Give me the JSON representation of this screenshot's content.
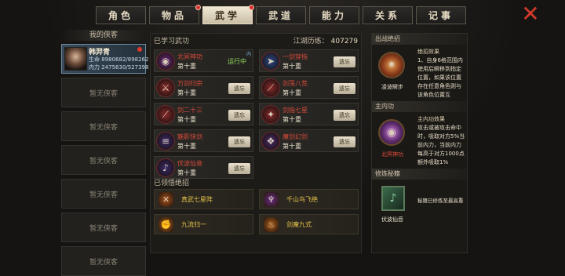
{
  "tabs": [
    {
      "label": "角色",
      "active": false,
      "dot": false
    },
    {
      "label": "物品",
      "active": false,
      "dot": true
    },
    {
      "label": "武学",
      "active": true,
      "dot": true
    },
    {
      "label": "武道",
      "active": false,
      "dot": false
    },
    {
      "label": "能力",
      "active": false,
      "dot": false
    },
    {
      "label": "关系",
      "active": false,
      "dot": false
    },
    {
      "label": "记事",
      "active": false,
      "dot": false
    }
  ],
  "left": {
    "title": "我的侠客",
    "hero": {
      "name": "韩羿青",
      "hp_label": "生命",
      "hp": "8980682/898262",
      "mp_label": "内力",
      "mp": "2475630/527398"
    },
    "empty_slot": "暂无侠客"
  },
  "middle": {
    "header": "已学习武功",
    "exp_label": "江湖历练：",
    "exp_value": "407279",
    "skills": [
      {
        "name": "北冥神功",
        "level": "第十重",
        "status": "运行中",
        "tag": "内",
        "icon": "swirl-icon",
        "color": "#6a2a7a"
      },
      {
        "name": "一剑穿指",
        "level": "第十重",
        "status": "遗忘",
        "icon": "arrow-icon",
        "color": "#2a4a8a"
      },
      {
        "name": "万剑归宗",
        "level": "第十重",
        "status": "遗忘",
        "icon": "sword-icon",
        "color": "#8a2a2a"
      },
      {
        "name": "剑荡八荒",
        "level": "第十重",
        "status": "遗忘",
        "icon": "slash-icon",
        "color": "#8a2a2a"
      },
      {
        "name": "剑二十三",
        "level": "第十重",
        "status": "遗忘",
        "icon": "blade-icon",
        "color": "#8a2a2a"
      },
      {
        "name": "剑指七星",
        "level": "第十重",
        "status": "遗忘",
        "icon": "star-icon",
        "color": "#8a2a2a"
      },
      {
        "name": "魅影快剑",
        "level": "第十重",
        "status": "遗忘",
        "icon": "strike-icon",
        "color": "#3a2a6a"
      },
      {
        "name": "魔剑幻剑",
        "level": "第十重",
        "status": "遗忘",
        "icon": "feather-icon",
        "color": "#4a2a6a"
      },
      {
        "name": "伏波仙音",
        "level": "第十重",
        "status": "遗忘",
        "icon": "music-icon",
        "color": "#3a2a6a"
      }
    ],
    "sub_header": "已领悟绝招",
    "zhaos": [
      {
        "name": "真武七星阵",
        "icon": "cross-swords-icon",
        "color": "#a8501a"
      },
      {
        "name": "千山鸟飞绝",
        "icon": "bird-icon",
        "color": "#6a2a8a"
      },
      {
        "name": "九流归一",
        "icon": "fist-icon",
        "color": "#b0601a"
      },
      {
        "name": "剑魔九式",
        "icon": "flame-icon",
        "color": "#b0601a"
      }
    ]
  },
  "right": {
    "sec1": "出战绝招",
    "ult_name": "凌波瞬步",
    "ult_effect_title": "绝招效果",
    "ult_effect": "1、自身6格范围内使用后瞬移到指定位置，如果该位置存在任意角色则与该角色位置互",
    "sec2": "主内功",
    "inner_name": "北冥神功",
    "inner_effect_title": "主内功效果",
    "inner_effect": "攻击或被攻击命中时，吸取对方5%当前内力，当前内力每高于对方1000点额外吸取1%",
    "sec3": "修炼秘籍",
    "book_name": "伏波仙音",
    "book_status": "秘籍已修炼至最高重"
  }
}
